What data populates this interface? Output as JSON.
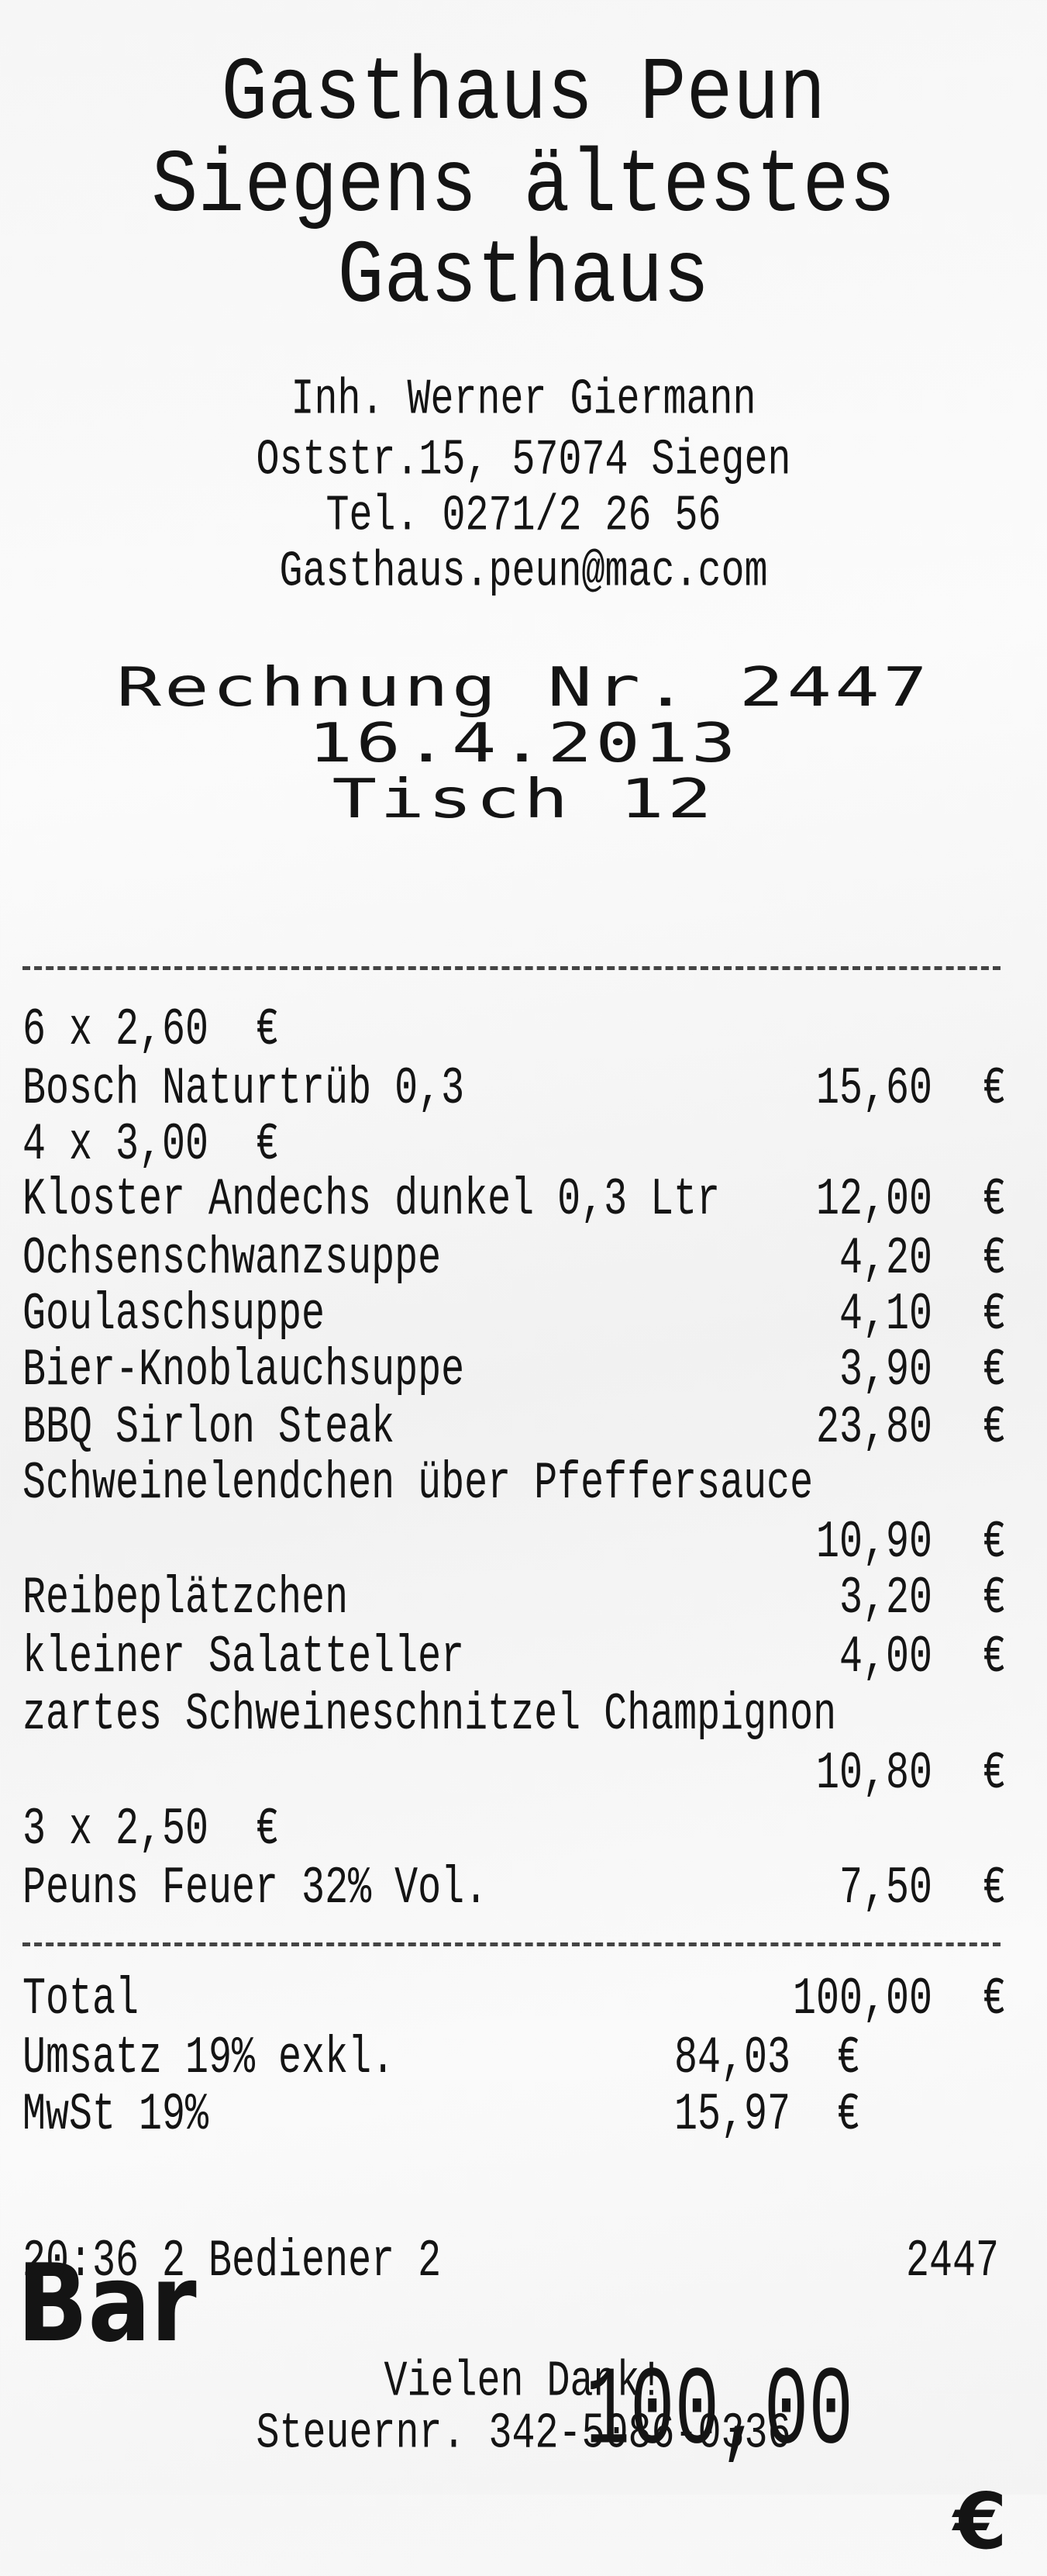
{
  "header": {
    "title_lines": [
      "Gasthaus Peun",
      "Siegens ältestes",
      "Gasthaus"
    ],
    "owner": "Inh. Werner Giermann",
    "address": "Oststr.15, 57074 Siegen",
    "phone": "Tel. 0271/2 26 56",
    "email": "Gasthaus.peun@mac.com"
  },
  "invoice": {
    "number_line": "Rechnung Nr. 2447",
    "date": "16.4.2013",
    "table": "Tisch 12"
  },
  "currency": "€",
  "items": [
    {
      "qty_line": "6 x 2,60"
    },
    {
      "name": "Bosch Naturtrüb 0,3",
      "amount": "15,60"
    },
    {
      "qty_line": "4 x 3,00"
    },
    {
      "name": "Kloster Andechs dunkel 0,3 Ltr",
      "amount": "12,00"
    },
    {
      "name": "Ochsenschwanzsuppe",
      "amount": "4,20"
    },
    {
      "name": "Goulaschsuppe",
      "amount": "4,10"
    },
    {
      "name": "Bier-Knoblauchsuppe",
      "amount": "3,90"
    },
    {
      "name": "BBQ Sirlon Steak",
      "amount": "23,80"
    },
    {
      "name": "Schweinelendchen über Pfeffersauce"
    },
    {
      "amount": "10,90"
    },
    {
      "name": "Reibeplätzchen",
      "amount": "3,20"
    },
    {
      "name": "kleiner Salatteller",
      "amount": "4,00"
    },
    {
      "name": "zartes Schweineschnitzel Champignon"
    },
    {
      "amount": "10,80"
    },
    {
      "qty_line": "3 x 2,50"
    },
    {
      "name": "Peuns Feuer 32% Vol.",
      "amount": "7,50"
    }
  ],
  "totals": {
    "total_label": "Total",
    "total": "100,00",
    "net_label": "Umsatz 19% exkl.",
    "net": "84,03",
    "vat_label": "MwSt 19%",
    "vat": "15,97",
    "payment_label": "Bar",
    "payment": "100,00"
  },
  "footer": {
    "meta": "20:36 2 Bediener 2",
    "receipt_no": "2447",
    "thanks": "Vielen Dank!",
    "tax_no": "Steuernr. 342-5086-0336"
  }
}
